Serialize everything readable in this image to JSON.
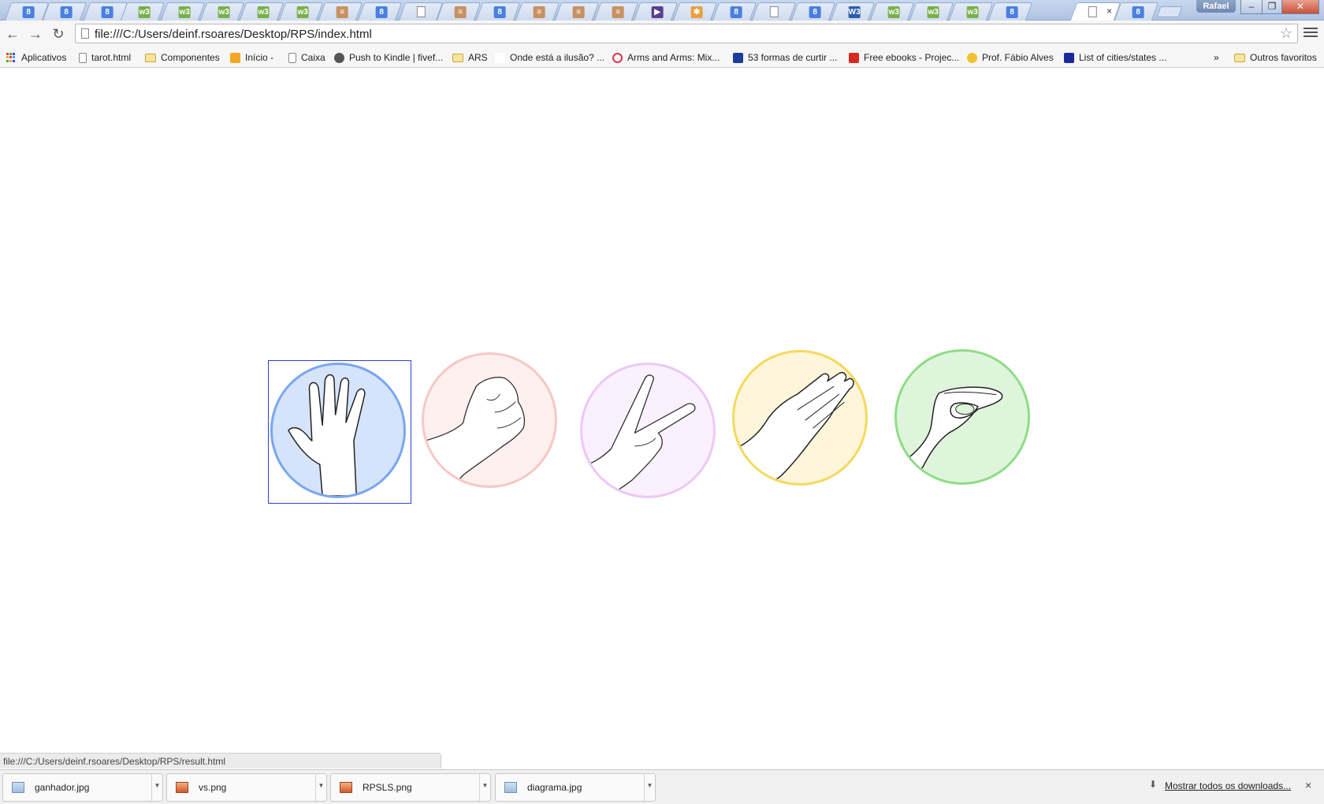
{
  "window": {
    "profile_name": "Rafael",
    "minimize": "–",
    "restore": "❐",
    "close": "✕"
  },
  "tabs": [
    {
      "icon": "google-icon",
      "color": "#4a7fe0",
      "glyph": "8"
    },
    {
      "icon": "google-icon",
      "color": "#4a7fe0",
      "glyph": "8"
    },
    {
      "icon": "google-icon",
      "color": "#4a7fe0",
      "glyph": "8"
    },
    {
      "icon": "w3schools-icon",
      "color": "#79b04a",
      "glyph": "w3"
    },
    {
      "icon": "w3schools-icon",
      "color": "#79b04a",
      "glyph": "w3"
    },
    {
      "icon": "w3schools-icon",
      "color": "#79b04a",
      "glyph": "w3"
    },
    {
      "icon": "w3schools-icon",
      "color": "#79b04a",
      "glyph": "w3"
    },
    {
      "icon": "w3schools-icon",
      "color": "#79b04a",
      "glyph": "w3"
    },
    {
      "icon": "stackoverflow-icon",
      "color": "#c89060",
      "glyph": "≡"
    },
    {
      "icon": "google-icon",
      "color": "#4a7fe0",
      "glyph": "8"
    },
    {
      "icon": "blank-page-icon",
      "color": "#ffffff",
      "glyph": ""
    },
    {
      "icon": "stackoverflow-icon",
      "color": "#c89060",
      "glyph": "≡"
    },
    {
      "icon": "google-icon",
      "color": "#4a7fe0",
      "glyph": "8"
    },
    {
      "icon": "stackoverflow-icon",
      "color": "#c89060",
      "glyph": "≡"
    },
    {
      "icon": "stackoverflow-icon",
      "color": "#c89060",
      "glyph": "≡"
    },
    {
      "icon": "stackoverflow-icon",
      "color": "#c89060",
      "glyph": "≡"
    },
    {
      "icon": "visual-studio-icon",
      "color": "#5a3e8e",
      "glyph": "▶"
    },
    {
      "icon": "asterisk-icon",
      "color": "#e8a040",
      "glyph": "✱"
    },
    {
      "icon": "google-icon",
      "color": "#4a7fe0",
      "glyph": "8"
    },
    {
      "icon": "blank-page-icon",
      "color": "#ffffff",
      "glyph": ""
    },
    {
      "icon": "google-icon",
      "color": "#4a7fe0",
      "glyph": "8"
    },
    {
      "icon": "w3c-icon",
      "color": "#2a5db0",
      "glyph": "W3"
    },
    {
      "icon": "w3schools-icon",
      "color": "#79b04a",
      "glyph": "w3"
    },
    {
      "icon": "w3schools-icon",
      "color": "#79b04a",
      "glyph": "w3"
    },
    {
      "icon": "w3schools-icon",
      "color": "#79b04a",
      "glyph": "w3"
    },
    {
      "icon": "google-icon",
      "color": "#4a7fe0",
      "glyph": "8"
    },
    {
      "icon": "blank-page-icon",
      "color": "#ffffff",
      "glyph": "",
      "active": true,
      "close": "×"
    },
    {
      "icon": "google-icon",
      "color": "#4a7fe0",
      "glyph": "8"
    }
  ],
  "toolbar": {
    "back": "←",
    "forward": "→",
    "reload": "↻",
    "url": "file:///C:/Users/deinf.rsoares/Desktop/RPS/index.html",
    "star": "☆"
  },
  "bookmarks": {
    "items": [
      {
        "label": "Aplicativos",
        "icon": "apps-grid-icon"
      },
      {
        "label": "tarot.html",
        "icon": "document-icon"
      },
      {
        "label": "Componentes",
        "icon": "folder-icon"
      },
      {
        "label": "Início -",
        "icon": "rss-icon"
      },
      {
        "label": "Caixa",
        "icon": "document-icon"
      },
      {
        "label": "Push to Kindle | fivef...",
        "icon": "kindle-icon"
      },
      {
        "label": "ARS",
        "icon": "folder-icon"
      },
      {
        "label": "Onde está a ilusão? ...",
        "icon": "y-icon"
      },
      {
        "label": "Arms and Arms: Mix...",
        "icon": "pocket-icon"
      },
      {
        "label": "53 formas de curtir ...",
        "icon": "bookmark-icon"
      },
      {
        "label": "Free ebooks - Projec...",
        "icon": "gutenberg-icon"
      },
      {
        "label": "Prof. Fábio Alves",
        "icon": "drive-icon"
      },
      {
        "label": "List of cities/states ...",
        "icon": "book-icon"
      }
    ],
    "overflow": "»",
    "other": "Outros favoritos"
  },
  "game": {
    "choices": [
      {
        "name": "spock",
        "fill": "#d6e4fb",
        "stroke": "#7aa6ee",
        "selected": true
      },
      {
        "name": "rock",
        "fill": "#fdf0ef",
        "stroke": "#f6c8c4",
        "selected": false
      },
      {
        "name": "scissors",
        "fill": "#fbf0fd",
        "stroke": "#edc8f6",
        "selected": false
      },
      {
        "name": "paper",
        "fill": "#fef6da",
        "stroke": "#f5d95e",
        "selected": false
      },
      {
        "name": "lizard",
        "fill": "#def5dc",
        "stroke": "#8fdc88",
        "selected": false
      }
    ]
  },
  "status": {
    "text": "file:///C:/Users/deinf.rsoares/Desktop/RPS/result.html"
  },
  "downloads": {
    "items": [
      {
        "name": "ganhador.jpg",
        "type": "jpg"
      },
      {
        "name": "vs.png",
        "type": "png"
      },
      {
        "name": "RPSLS.png",
        "type": "png"
      },
      {
        "name": "diagrama.jpg",
        "type": "jpg"
      }
    ],
    "show_all": "Mostrar todos os downloads...",
    "close": "×"
  }
}
